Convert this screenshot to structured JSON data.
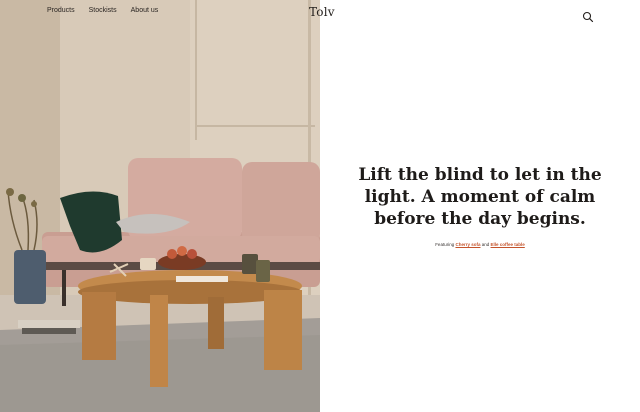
{
  "nav": {
    "links": [
      "Products",
      "Stockists",
      "About us"
    ]
  },
  "brand": {
    "logo_text": "Tolv"
  },
  "search": {
    "icon": "search-icon"
  },
  "hero": {
    "headline": "Lift the blind to let in the light. A moment of calm before the day begins.",
    "featuring": {
      "prefix": "Featuring",
      "link1": "Cherry sofa",
      "middle": "and",
      "link2": "Elle coffee table"
    }
  },
  "colors": {
    "link_accent": "#c4532b",
    "wall": "#d9ccbb",
    "sofa": "#cfa79b",
    "table": "#c48b4e"
  }
}
